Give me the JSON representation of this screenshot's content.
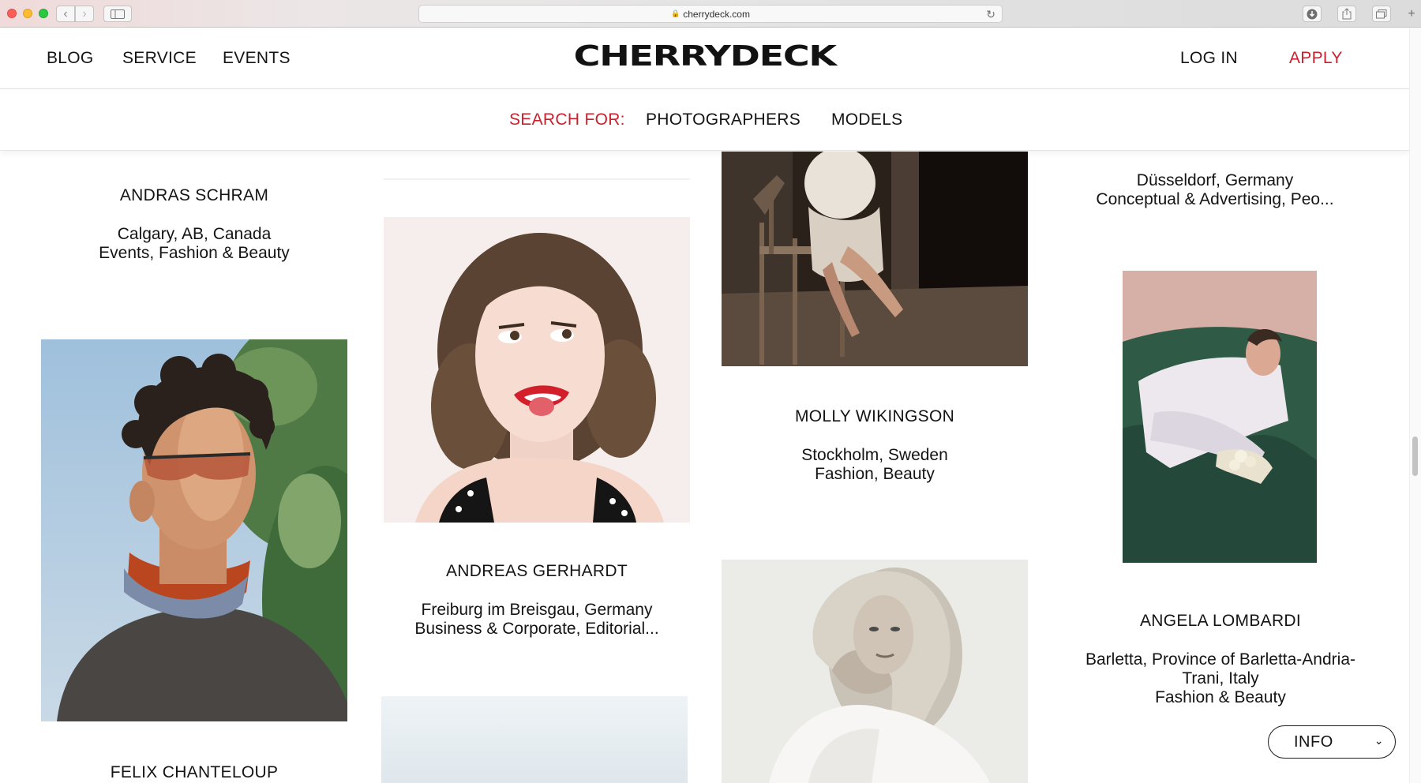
{
  "browser": {
    "url": "cherrydeck.com",
    "icons": [
      "back-arrow-icon",
      "forward-arrow-icon",
      "sidebar-icon",
      "lock-icon",
      "reload-icon",
      "download-icon",
      "share-icon",
      "tabs-icon",
      "plus-icon"
    ]
  },
  "header": {
    "nav_left": [
      "BLOG",
      "SERVICE",
      "EVENTS"
    ],
    "logo": "CHERRYDECK",
    "login": "LOG IN",
    "apply": "APPLY"
  },
  "search": {
    "label": "SEARCH FOR:",
    "options": [
      "PHOTOGRAPHERS",
      "MODELS"
    ]
  },
  "colors": {
    "accent_red": "#c8202d",
    "text": "#141414"
  },
  "cards": {
    "andras": {
      "name": "ANDRAS SCHRAM",
      "location": "Calgary, AB, Canada",
      "specialties": "Events, Fashion & Beauty"
    },
    "andreas": {
      "name": "ANDREAS GERHARDT",
      "location": "Freiburg im Breisgau, Germany",
      "specialties": "Business & Corporate, Editorial..."
    },
    "molly": {
      "name": "MOLLY WIKINGSON",
      "location": "Stockholm, Sweden",
      "specialties": "Fashion, Beauty"
    },
    "dusseldorf": {
      "location": "Düsseldorf, Germany",
      "specialties": "Conceptual & Advertising, Peo..."
    },
    "angela": {
      "name": "ANGELA LOMBARDI",
      "location_line1": "Barletta, Province of Barletta-Andria-",
      "location_line2": "Trani, Italy",
      "specialties": "Fashion & Beauty"
    },
    "felix": {
      "name": "FELIX CHANTELOUP"
    }
  },
  "info_button": {
    "label": "INFO"
  }
}
